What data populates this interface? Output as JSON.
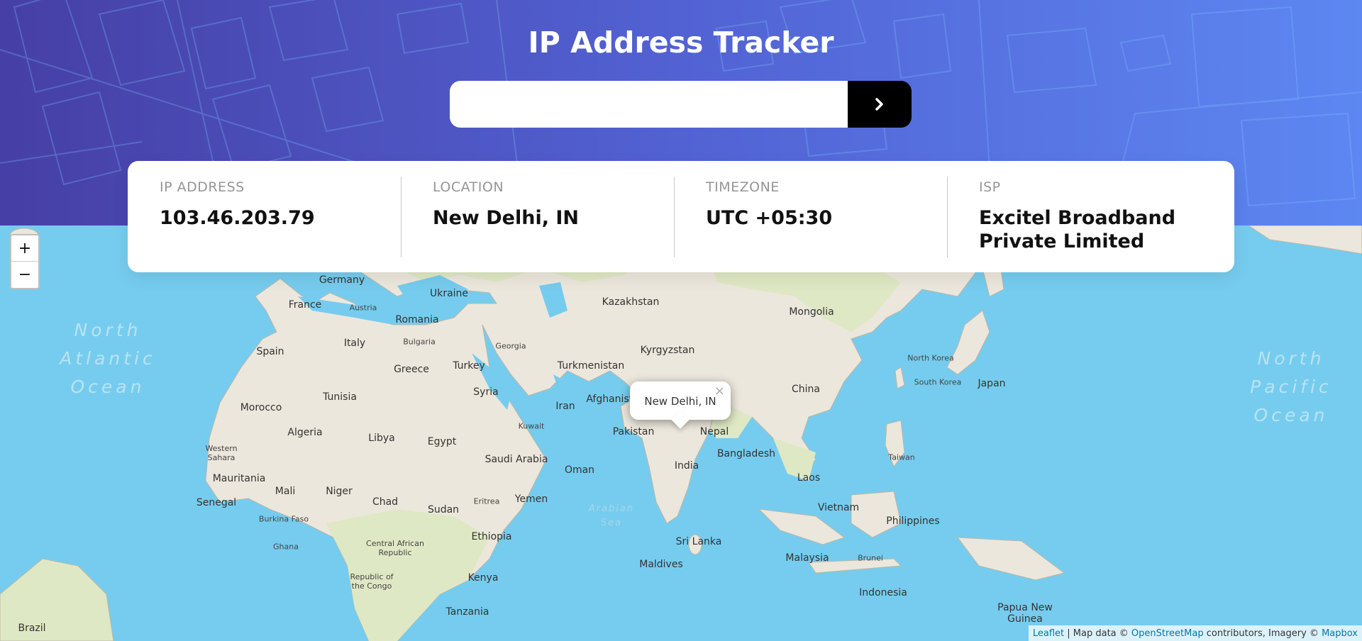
{
  "app": {
    "title": "IP Address Tracker"
  },
  "search": {
    "value": "",
    "placeholder": "",
    "button_icon": "chevron-right-icon"
  },
  "info": [
    {
      "label": "IP ADDRESS",
      "value": "103.46.203.79"
    },
    {
      "label": "LOCATION",
      "value": "New Delhi, IN"
    },
    {
      "label": "TIMEZONE",
      "value": "UTC +05:30"
    },
    {
      "label": "ISP",
      "value": "Excitel Broadband Private Limited"
    }
  ],
  "map": {
    "zoom_in": "+",
    "zoom_out": "−",
    "popup": {
      "text": "New Delhi, IN",
      "close": "×"
    },
    "countries": [
      "Germany",
      "Ukraine",
      "France",
      "Austria",
      "Romania",
      "Kazakhstan",
      "Mongolia",
      "Spain",
      "Italy",
      "Bulgaria",
      "Georgia",
      "Kyrgyzstan",
      "Turkmenistan",
      "Turkey",
      "Greece",
      "North Korea",
      "South Korea",
      "Japan",
      "China",
      "Syria",
      "Tunisia",
      "Morocco",
      "Iran",
      "Afghanistan",
      "Algeria",
      "Libya",
      "Egypt",
      "Kuwait",
      "Pakistan",
      "Nepal",
      "Western Sahara",
      "Saudi Arabia",
      "Bangladesh",
      "Taiwan",
      "Oman",
      "India",
      "Mauritania",
      "Mali",
      "Niger",
      "Laos",
      "Senegal",
      "Chad",
      "Yemen",
      "Eritrea",
      "Sudan",
      "Vietnam",
      "Philippines",
      "Burkina Faso",
      "Ethiopia",
      "Sri Lanka",
      "Ghana",
      "Central African Republic",
      "Malaysia",
      "Brunei",
      "Maldives",
      "Republic of the Congo",
      "Kenya",
      "Indonesia",
      "Papua New Guinea",
      "Tanzania",
      "Brazil"
    ],
    "oceans": [
      "North Atlantic Ocean",
      "North Pacific Ocean",
      "Arabian Sea"
    ],
    "attribution": {
      "leaflet": "Leaflet",
      "text1": " | Map data © ",
      "osm": "OpenStreetMap",
      "text2": " contributors, Imagery © ",
      "mapbox": "Mapbox"
    }
  },
  "colors": {
    "header_start": "#463fa5",
    "header_end": "#5d87f2",
    "ocean": "#76ccee",
    "land": "#f0ede4",
    "desert": "#efe8dc",
    "vegetation": "#dfe8c4",
    "button": "#000000"
  }
}
